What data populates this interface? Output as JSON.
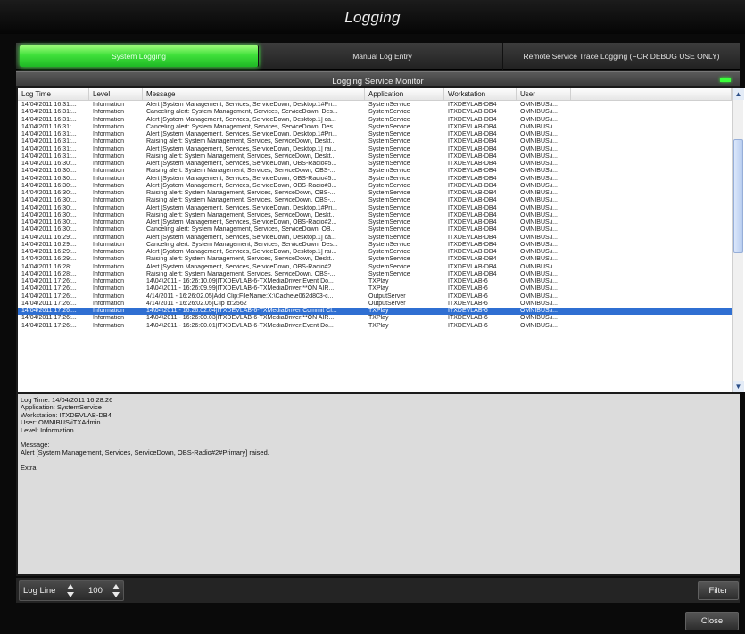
{
  "window": {
    "title": "Logging"
  },
  "tabs": [
    {
      "label": "System Logging",
      "active": true
    },
    {
      "label": "Manual Log Entry",
      "active": false
    },
    {
      "label": "Remote Service Trace Logging (FOR DEBUG USE ONLY)",
      "active": false
    }
  ],
  "monitor": {
    "title": "Logging Service Monitor",
    "status_color": "#3bff3b"
  },
  "grid": {
    "columns": [
      "Log Time",
      "Level",
      "Message",
      "Application",
      "Workstation",
      "User"
    ],
    "selected_row": 28,
    "rows": [
      [
        "14/04/2011 16:31:...",
        "Information",
        "Alert [System Management, Services, ServiceDown, Desktop.1#Pri...",
        "SystemService",
        "ITXDEVLAB-DB4",
        "OMNIBUS\\i..."
      ],
      [
        "14/04/2011 16:31:...",
        "Information",
        "Canceling alert: System Management, Services, ServiceDown, Des...",
        "SystemService",
        "ITXDEVLAB-DB4",
        "OMNIBUS\\i..."
      ],
      [
        "14/04/2011 16:31:...",
        "Information",
        "Alert [System Management, Services, ServiceDown, Desktop.1] ca...",
        "SystemService",
        "ITXDEVLAB-DB4",
        "OMNIBUS\\i..."
      ],
      [
        "14/04/2011 16:31:...",
        "Information",
        "Canceling alert: System Management, Services, ServiceDown, Des...",
        "SystemService",
        "ITXDEVLAB-DB4",
        "OMNIBUS\\i..."
      ],
      [
        "14/04/2011 16:31:...",
        "Information",
        "Alert [System Management, Services, ServiceDown, Desktop.1#Pri...",
        "SystemService",
        "ITXDEVLAB-DB4",
        "OMNIBUS\\i..."
      ],
      [
        "14/04/2011 16:31:...",
        "Information",
        "Raising alert: System Management, Services, ServiceDown, Deskt...",
        "SystemService",
        "ITXDEVLAB-DB4",
        "OMNIBUS\\i..."
      ],
      [
        "14/04/2011 16:31:...",
        "Information",
        "Alert [System Management, Services, ServiceDown, Desktop.1] rai...",
        "SystemService",
        "ITXDEVLAB-DB4",
        "OMNIBUS\\i..."
      ],
      [
        "14/04/2011 16:31:...",
        "Information",
        "Raising alert: System Management, Services, ServiceDown, Deskt...",
        "SystemService",
        "ITXDEVLAB-DB4",
        "OMNIBUS\\i..."
      ],
      [
        "14/04/2011 16:30:...",
        "Information",
        "Alert [System Management, Services, ServiceDown, OBS-Radio#5...",
        "SystemService",
        "ITXDEVLAB-DB4",
        "OMNIBUS\\i..."
      ],
      [
        "14/04/2011 16:30:...",
        "Information",
        "Raising alert: System Management, Services, ServiceDown, OBS-...",
        "SystemService",
        "ITXDEVLAB-DB4",
        "OMNIBUS\\i..."
      ],
      [
        "14/04/2011 16:30:...",
        "Information",
        "Alert [System Management, Services, ServiceDown, OBS-Radio#5...",
        "SystemService",
        "ITXDEVLAB-DB4",
        "OMNIBUS\\i..."
      ],
      [
        "14/04/2011 16:30:...",
        "Information",
        "Alert [System Management, Services, ServiceDown, OBS-Radio#3...",
        "SystemService",
        "ITXDEVLAB-DB4",
        "OMNIBUS\\i..."
      ],
      [
        "14/04/2011 16:30:...",
        "Information",
        "Raising alert: System Management, Services, ServiceDown, OBS-...",
        "SystemService",
        "ITXDEVLAB-DB4",
        "OMNIBUS\\i..."
      ],
      [
        "14/04/2011 16:30:...",
        "Information",
        "Raising alert: System Management, Services, ServiceDown, OBS-...",
        "SystemService",
        "ITXDEVLAB-DB4",
        "OMNIBUS\\i..."
      ],
      [
        "14/04/2011 16:30:...",
        "Information",
        "Alert [System Management, Services, ServiceDown, Desktop.1#Pri...",
        "SystemService",
        "ITXDEVLAB-DB4",
        "OMNIBUS\\i..."
      ],
      [
        "14/04/2011 16:30:...",
        "Information",
        "Raising alert: System Management, Services, ServiceDown, Deskt...",
        "SystemService",
        "ITXDEVLAB-DB4",
        "OMNIBUS\\i..."
      ],
      [
        "14/04/2011 16:30:...",
        "Information",
        "Alert [System Management, Services, ServiceDown, OBS-Radio#2...",
        "SystemService",
        "ITXDEVLAB-DB4",
        "OMNIBUS\\i..."
      ],
      [
        "14/04/2011 16:30:...",
        "Information",
        "Canceling alert: System Management, Services, ServiceDown, OB...",
        "SystemService",
        "ITXDEVLAB-DB4",
        "OMNIBUS\\i..."
      ],
      [
        "14/04/2011 16:29:...",
        "Information",
        "Alert [System Management, Services, ServiceDown, Desktop.1] ca...",
        "SystemService",
        "ITXDEVLAB-DB4",
        "OMNIBUS\\i..."
      ],
      [
        "14/04/2011 16:29:...",
        "Information",
        "Canceling alert: System Management, Services, ServiceDown, Des...",
        "SystemService",
        "ITXDEVLAB-DB4",
        "OMNIBUS\\i..."
      ],
      [
        "14/04/2011 16:29:...",
        "Information",
        "Alert [System Management, Services, ServiceDown, Desktop.1] rai...",
        "SystemService",
        "ITXDEVLAB-DB4",
        "OMNIBUS\\i..."
      ],
      [
        "14/04/2011 16:29:...",
        "Information",
        "Raising alert: System Management, Services, ServiceDown, Deskt...",
        "SystemService",
        "ITXDEVLAB-DB4",
        "OMNIBUS\\i..."
      ],
      [
        "14/04/2011 16:28:...",
        "Information",
        "Alert [System Management, Services, ServiceDown, OBS-Radio#2...",
        "SystemService",
        "ITXDEVLAB-DB4",
        "OMNIBUS\\i..."
      ],
      [
        "14/04/2011 16:28:...",
        "Information",
        "Raising alert: System Management, Services, ServiceDown, OBS-...",
        "SystemService",
        "ITXDEVLAB-DB4",
        "OMNIBUS\\i..."
      ],
      [
        "14/04/2011 17:26:...",
        "Information",
        "14\\04\\2011 - 16:26:10.09|ITXDEVLAB-6-TXMediaDriver:Event Do...",
        "TXPlay",
        "ITXDEVLAB-6",
        "OMNIBUS\\i..."
      ],
      [
        "14/04/2011 17:26:...",
        "Information",
        "14\\04\\2011 - 16:26:09.99|ITXDEVLAB-6-TXMediaDriver:**ON AIR...",
        "TXPlay",
        "ITXDEVLAB-6",
        "OMNIBUS\\i..."
      ],
      [
        "14/04/2011 17:26:...",
        "Information",
        "4/14/2011 - 16:26:02.05|Add Clip:FileName:X:\\Cache\\e062d803-c...",
        "OutputServer",
        "ITXDEVLAB-6",
        "OMNIBUS\\i..."
      ],
      [
        "14/04/2011 17:26:...",
        "Information",
        "4/14/2011 - 16:26:02.05|Clip id:2562",
        "OutputServer",
        "ITXDEVLAB-6",
        "OMNIBUS\\i..."
      ],
      [
        "14/04/2011 17:26:...",
        "Information",
        "14\\04\\2011 - 16:26:02.04|ITXDEVLAB-6-TXMediaDriver:Commit Cl...",
        "TXPlay",
        "ITXDEVLAB-6",
        "OMNIBUS\\i..."
      ],
      [
        "14/04/2011 17:26:...",
        "Information",
        "14\\04\\2011 - 16:26:00.03|ITXDEVLAB-6-TXMediaDriver:**ON AIR...",
        "TXPlay",
        "ITXDEVLAB-6",
        "OMNIBUS\\i..."
      ],
      [
        "14/04/2011 17:26:...",
        "Information",
        "14\\04\\2011 - 16:26:00.01|ITXDEVLAB-6-TXMediaDriver:Event Do...",
        "TXPlay",
        "ITXDEVLAB-6",
        "OMNIBUS\\i..."
      ]
    ]
  },
  "detail": {
    "lines": [
      "Log Time: 14/04/2011 16:28:26",
      "Application: SystemService",
      "Workstation: ITXDEVLAB-DB4",
      "User: OMNIBUS\\iTXAdmin",
      "Level: Information",
      "",
      "Message:",
      "Alert [System Management, Services, ServiceDown, OBS-Radio#2#Primary] raised.",
      "",
      "Extra:"
    ]
  },
  "controls": {
    "log_line_label": "Log Line",
    "log_line_value": "100",
    "filter_label": "Filter",
    "close_label": "Close"
  }
}
